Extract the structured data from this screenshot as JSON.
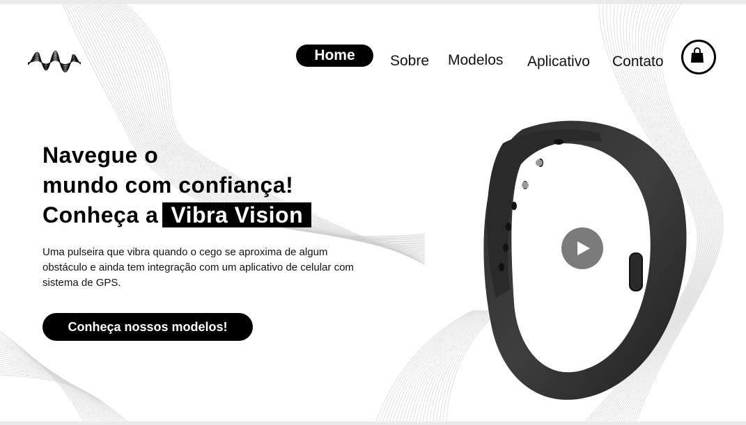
{
  "nav": {
    "items": [
      {
        "label": "Home",
        "active": true
      },
      {
        "label": "Sobre"
      },
      {
        "label": "Modelos"
      },
      {
        "label": "Aplicativo"
      },
      {
        "label": "Contato"
      }
    ],
    "cart_icon": "shopping-bag-icon"
  },
  "hero": {
    "title_line1": "Navegue o",
    "title_line2": "mundo com confiança!",
    "title_line3_prefix": "Conheça a",
    "brand": "Vibra Vision",
    "description": "Uma pulseira que vibra quando o cego se aproxima de algum obstáculo e ainda tem integração com um aplicativo de celular com sistema de GPS.",
    "cta_label": "Conheça nossos modelos!"
  },
  "media": {
    "product_image": "black-wristband",
    "play_icon": "play-icon"
  },
  "colors": {
    "primary": "#000000",
    "background": "#ffffff",
    "play_button": "#646464"
  }
}
